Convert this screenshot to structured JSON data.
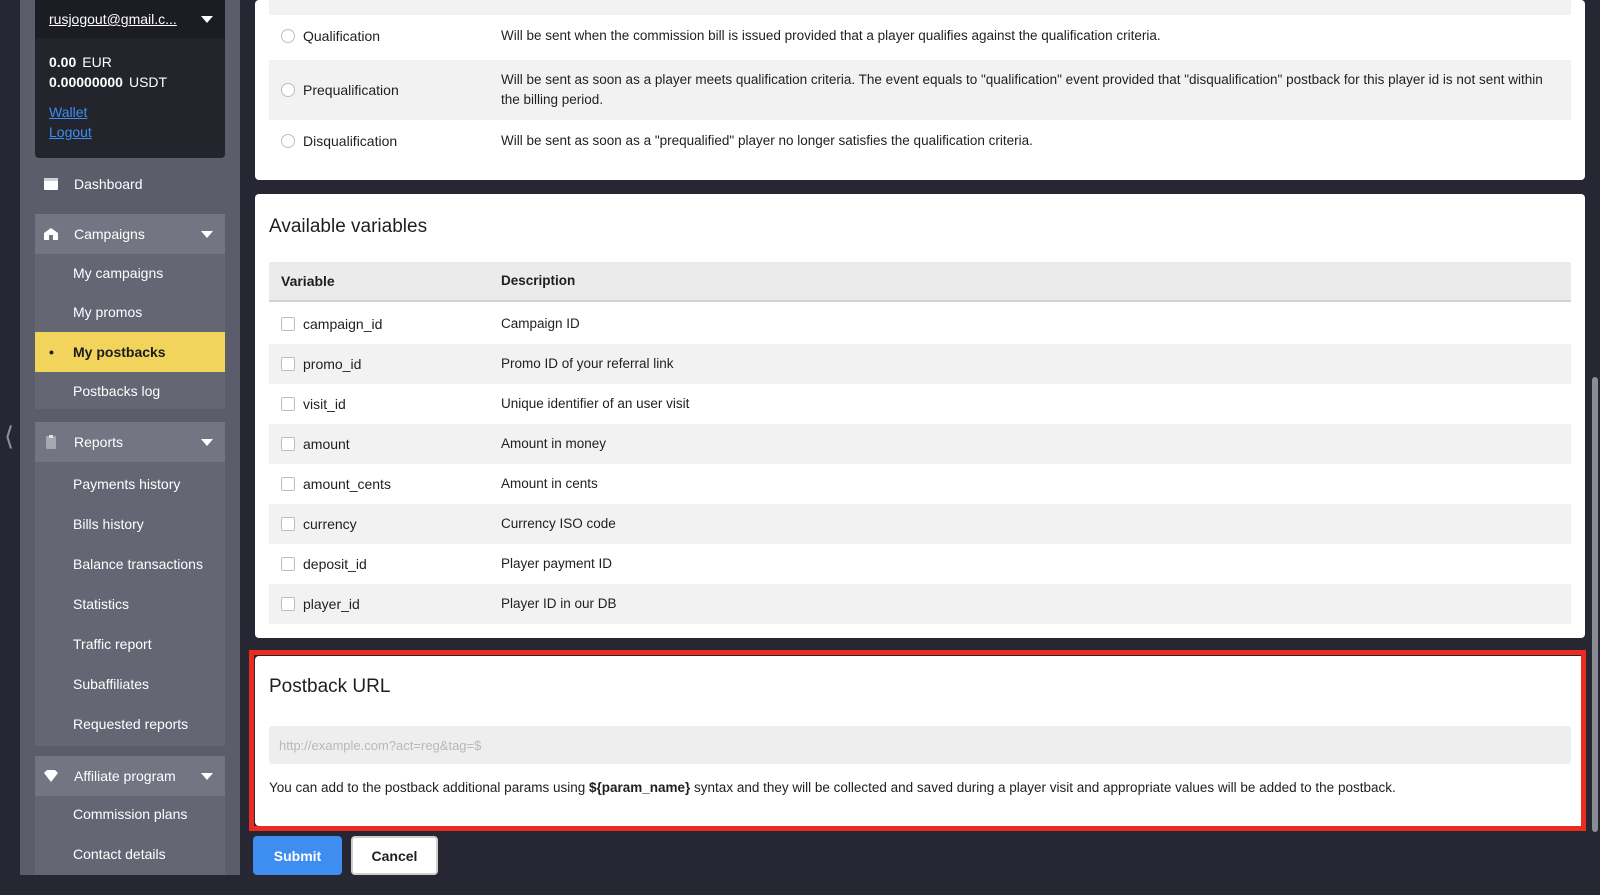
{
  "user": {
    "email": "rusjogout@gmail.c...",
    "balances": [
      {
        "amount": "0.00",
        "currency": "EUR"
      },
      {
        "amount": "0.00000000",
        "currency": "USDT"
      }
    ],
    "wallet_link": "Wallet",
    "logout_link": "Logout"
  },
  "sidebar": {
    "dashboard": "Dashboard",
    "campaigns": {
      "label": "Campaigns",
      "items": [
        "My campaigns",
        "My promos",
        "My postbacks",
        "Postbacks log"
      ],
      "active": "My postbacks"
    },
    "reports": {
      "label": "Reports",
      "items": [
        "Payments history",
        "Bills history",
        "Balance transactions",
        "Statistics",
        "Traffic report",
        "Subaffiliates",
        "Requested reports"
      ]
    },
    "affiliate": {
      "label": "Affiliate program",
      "items": [
        "Commission plans",
        "Contact details"
      ]
    }
  },
  "events": [
    {
      "name": "Qualification",
      "description": "Will be sent when the commission bill is issued provided that a player qualifies against the qualification criteria."
    },
    {
      "name": "Prequalification",
      "description": "Will be sent as soon as a player meets qualification criteria. The event equals to \"qualification\" event provided that \"disqualification\" postback for this player id is not sent within the billing period."
    },
    {
      "name": "Disqualification",
      "description": "Will be sent as soon as a \"prequalified\" player no longer satisfies the qualification criteria."
    }
  ],
  "variables_section": {
    "title": "Available variables",
    "col_variable": "Variable",
    "col_description": "Description",
    "rows": [
      {
        "name": "campaign_id",
        "description": "Campaign ID"
      },
      {
        "name": "promo_id",
        "description": "Promo ID of your referral link"
      },
      {
        "name": "visit_id",
        "description": "Unique identifier of an user visit"
      },
      {
        "name": "amount",
        "description": "Amount in money"
      },
      {
        "name": "amount_cents",
        "description": "Amount in cents"
      },
      {
        "name": "currency",
        "description": "Currency ISO code"
      },
      {
        "name": "deposit_id",
        "description": "Player payment ID"
      },
      {
        "name": "player_id",
        "description": "Player ID in our DB"
      }
    ]
  },
  "postback_section": {
    "title": "Postback URL",
    "url_value": "",
    "url_placeholder": "http://example.com?act=reg&tag=$",
    "help_prefix": "You can add to the postback additional params using ",
    "help_bold": "${param_name}",
    "help_suffix": " syntax and they will be collected and saved during a player visit and appropriate values will be added to the postback."
  },
  "buttons": {
    "submit": "Submit",
    "cancel": "Cancel"
  },
  "colors": {
    "accent": "#3d8ef0",
    "active_nav": "#f2d45c",
    "highlight": "#ea2b1f"
  }
}
